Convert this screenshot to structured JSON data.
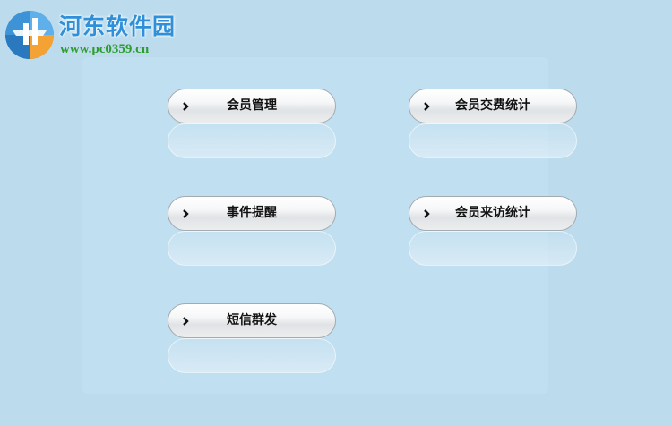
{
  "watermark": {
    "title": "河东软件园",
    "url": "www.pc0359.cn"
  },
  "menu": {
    "member_management": "会员管理",
    "member_fee_stats": "会员交费统计",
    "event_reminder": "事件提醒",
    "member_visit_stats": "会员来访统计",
    "sms_broadcast": "短信群发"
  },
  "icons": {
    "logo": "hedong-logo-icon",
    "button_arrow": "chevron-right-icon"
  },
  "colors": {
    "background": "#bcdcee",
    "logo_text": "#2f8fd8",
    "logo_url": "#2e9c2e"
  }
}
